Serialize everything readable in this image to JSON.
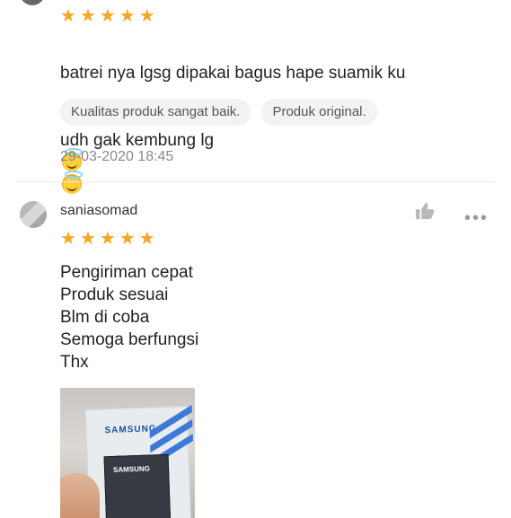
{
  "review1": {
    "rating": 5,
    "stars": [
      "★",
      "★",
      "★",
      "★",
      "★"
    ],
    "text_line1": "batrei nya lgsg dipakai bagus hape suamik ku",
    "text_line2": "udh gak kembung lg",
    "emoji_icon": "smiling-face-with-halo-icon",
    "tags": [
      "Kualitas produk sangat baik.",
      "Produk original."
    ],
    "timestamp": "29-03-2020 18:45"
  },
  "review2": {
    "username": "saniasomad",
    "rating": 5,
    "stars": [
      "★",
      "★",
      "★",
      "★",
      "★"
    ],
    "text": "Pengiriman cepat\nProduk sesuai\nBlm di coba\nSemoga berfungsi\nThx",
    "like_icon": "thumbs-up-icon",
    "more_icon": "more-options-icon",
    "photo": {
      "brand": "SAMSUNG",
      "battery_label": "SAMSUNG"
    }
  },
  "colors": {
    "star": "#f5a623",
    "tag_bg": "#f3f3f3",
    "muted_text": "#8a8a8a"
  }
}
